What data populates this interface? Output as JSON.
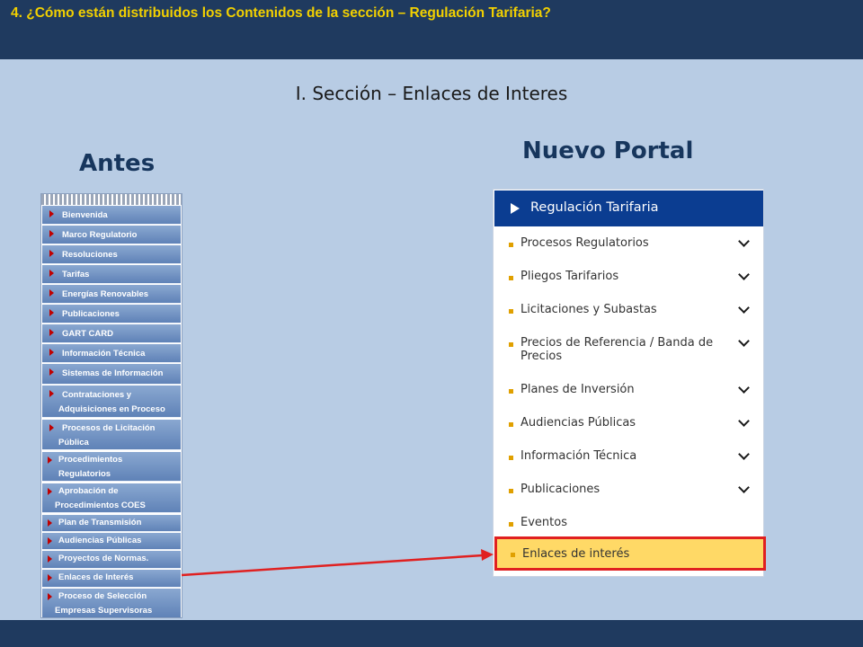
{
  "header": {
    "title": "4. ¿Cómo están distribuidos los Contenidos de la sección –  Regulación Tarifaria?"
  },
  "subtitle": "I. Sección – Enlaces de Interes",
  "antes": {
    "heading": "Antes",
    "items": [
      {
        "l1": "Bienvenida",
        "l2": ""
      },
      {
        "l1": "Marco Regulatorio",
        "l2": ""
      },
      {
        "l1": "Resoluciones",
        "l2": ""
      },
      {
        "l1": "Tarifas",
        "l2": ""
      },
      {
        "l1": "Energías Renovables",
        "l2": ""
      },
      {
        "l1": "Publicaciones",
        "l2": ""
      },
      {
        "l1": "GART CARD",
        "l2": ""
      },
      {
        "l1": "Información Técnica",
        "l2": ""
      },
      {
        "l1": "Sistemas de Información",
        "l2": ""
      },
      {
        "l1": "Contrataciones y",
        "l2": "Adquisiciones en Proceso"
      },
      {
        "l1": "Procesos de Licitación",
        "l2": "Pública"
      },
      {
        "l1": "Procedimientos",
        "l2": "Regulatorios"
      },
      {
        "l1": "Aprobación de",
        "l2": "Procedimientos COES"
      },
      {
        "l1": "Plan de Transmisión",
        "l2": ""
      },
      {
        "l1": "Audiencias Públicas",
        "l2": ""
      },
      {
        "l1": "Proyectos de Normas.",
        "l2": ""
      },
      {
        "l1": "Enlaces de Interés",
        "l2": ""
      },
      {
        "l1": "Proceso de Selección",
        "l2": "Empresas Supervisoras"
      }
    ]
  },
  "nuevo": {
    "heading": "Nuevo Portal",
    "header": "Regulación Tarifaria",
    "items": [
      {
        "label": "Procesos Regulatorios",
        "has_chevron": true
      },
      {
        "label": "Pliegos Tarifarios",
        "has_chevron": true
      },
      {
        "label": "Licitaciones y Subastas",
        "has_chevron": true
      },
      {
        "label": "Precios de Referencia / Banda de Precios",
        "has_chevron": true
      },
      {
        "label": "Planes de Inversión",
        "has_chevron": true
      },
      {
        "label": "Audiencias Públicas",
        "has_chevron": true
      },
      {
        "label": "Información Técnica",
        "has_chevron": true
      },
      {
        "label": "Publicaciones",
        "has_chevron": true
      },
      {
        "label": "Eventos",
        "has_chevron": false
      }
    ],
    "highlighted": "Enlaces de interés"
  },
  "colors": {
    "bar": "#1f3a5f",
    "title": "#f2d000",
    "background": "#b8cce4",
    "portal_header": "#0b3d91",
    "highlight_fill": "#ffd966",
    "highlight_border": "#e02020"
  }
}
